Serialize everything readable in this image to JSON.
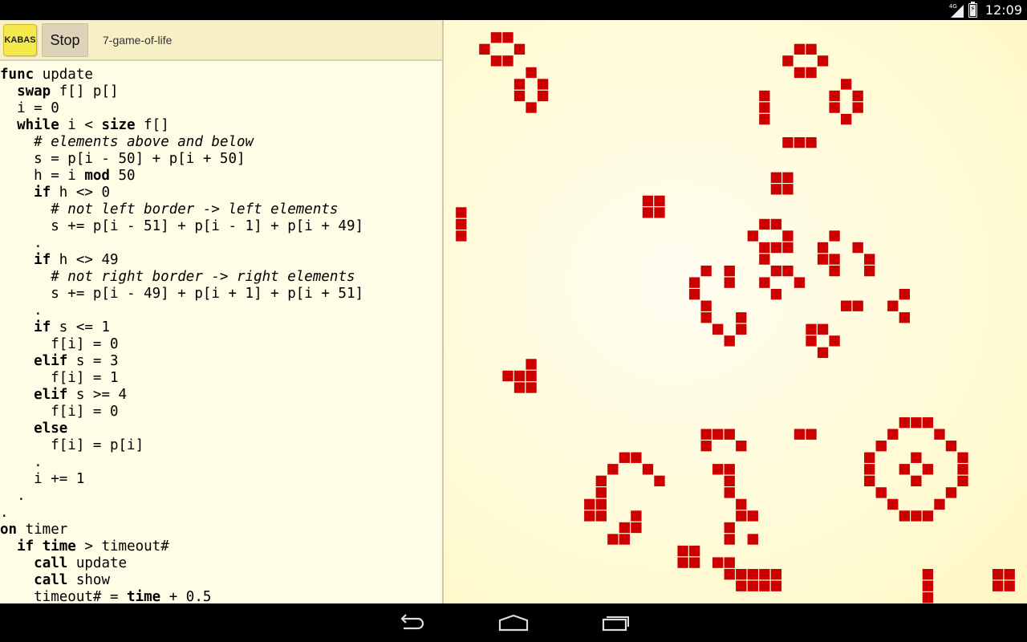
{
  "status_bar": {
    "network": "4G",
    "time": "12:09"
  },
  "toolbar": {
    "logo_text": "KABAS",
    "stop_label": "Stop",
    "program_name": "7-game-of-life"
  },
  "editor": {
    "lines": [
      [
        {
          "k": "kw",
          "t": "func"
        },
        {
          "k": "",
          "t": " update"
        }
      ],
      [
        {
          "k": "",
          "t": "  "
        },
        {
          "k": "kw",
          "t": "swap"
        },
        {
          "k": "",
          "t": " f[] p[]"
        }
      ],
      [
        {
          "k": "",
          "t": "  i = 0"
        }
      ],
      [
        {
          "k": "",
          "t": "  "
        },
        {
          "k": "kw",
          "t": "while"
        },
        {
          "k": "",
          "t": " i < "
        },
        {
          "k": "kw",
          "t": "size"
        },
        {
          "k": "",
          "t": " f[]"
        }
      ],
      [
        {
          "k": "",
          "t": "    "
        },
        {
          "k": "cm",
          "t": "# elements above and below"
        }
      ],
      [
        {
          "k": "",
          "t": "    s = p[i - 50] + p[i + 50]"
        }
      ],
      [
        {
          "k": "",
          "t": "    h = i "
        },
        {
          "k": "kw",
          "t": "mod"
        },
        {
          "k": "",
          "t": " 50"
        }
      ],
      [
        {
          "k": "",
          "t": "    "
        },
        {
          "k": "kw",
          "t": "if"
        },
        {
          "k": "",
          "t": " h <> 0"
        }
      ],
      [
        {
          "k": "",
          "t": "      "
        },
        {
          "k": "cm",
          "t": "# not left border -> left elements"
        }
      ],
      [
        {
          "k": "",
          "t": "      s += p[i - 51] + p[i - 1] + p[i + 49]"
        }
      ],
      [
        {
          "k": "",
          "t": "    ."
        }
      ],
      [
        {
          "k": "",
          "t": "    "
        },
        {
          "k": "kw",
          "t": "if"
        },
        {
          "k": "",
          "t": " h <> 49"
        }
      ],
      [
        {
          "k": "",
          "t": "      "
        },
        {
          "k": "cm",
          "t": "# not right border -> right elements"
        }
      ],
      [
        {
          "k": "",
          "t": "      s += p[i - 49] + p[i + 1] + p[i + 51]"
        }
      ],
      [
        {
          "k": "",
          "t": "    ."
        }
      ],
      [
        {
          "k": "",
          "t": "    "
        },
        {
          "k": "kw",
          "t": "if"
        },
        {
          "k": "",
          "t": " s <= 1"
        }
      ],
      [
        {
          "k": "",
          "t": "      f[i] = 0"
        }
      ],
      [
        {
          "k": "",
          "t": "    "
        },
        {
          "k": "kw",
          "t": "elif"
        },
        {
          "k": "",
          "t": " s = 3"
        }
      ],
      [
        {
          "k": "",
          "t": "      f[i] = 1"
        }
      ],
      [
        {
          "k": "",
          "t": "    "
        },
        {
          "k": "kw",
          "t": "elif"
        },
        {
          "k": "",
          "t": " s >= 4"
        }
      ],
      [
        {
          "k": "",
          "t": "      f[i] = 0"
        }
      ],
      [
        {
          "k": "",
          "t": "    "
        },
        {
          "k": "kw",
          "t": "else"
        }
      ],
      [
        {
          "k": "",
          "t": "      f[i] = p[i]"
        }
      ],
      [
        {
          "k": "",
          "t": "    ."
        }
      ],
      [
        {
          "k": "",
          "t": "    i += 1"
        }
      ],
      [
        {
          "k": "",
          "t": "  ."
        }
      ],
      [
        {
          "k": "",
          "t": "."
        }
      ],
      [
        {
          "k": "kw",
          "t": "on"
        },
        {
          "k": "",
          "t": " timer"
        }
      ],
      [
        {
          "k": "",
          "t": "  "
        },
        {
          "k": "kw",
          "t": "if"
        },
        {
          "k": "",
          "t": " "
        },
        {
          "k": "kw",
          "t": "time"
        },
        {
          "k": "",
          "t": " > timeout#"
        }
      ],
      [
        {
          "k": "",
          "t": "    "
        },
        {
          "k": "kw",
          "t": "call"
        },
        {
          "k": "",
          "t": " update"
        }
      ],
      [
        {
          "k": "",
          "t": "    "
        },
        {
          "k": "kw",
          "t": "call"
        },
        {
          "k": "",
          "t": " show"
        }
      ],
      [
        {
          "k": "",
          "t": "    timeout# = "
        },
        {
          "k": "kw",
          "t": "time"
        },
        {
          "k": "",
          "t": " + 0.5"
        }
      ]
    ]
  },
  "game": {
    "grid_size": 50,
    "cell_color": "#cc0000",
    "live_cells": [
      [
        4,
        1
      ],
      [
        5,
        1
      ],
      [
        3,
        2
      ],
      [
        6,
        2
      ],
      [
        4,
        3
      ],
      [
        5,
        3
      ],
      [
        7,
        4
      ],
      [
        6,
        5
      ],
      [
        8,
        5
      ],
      [
        6,
        6
      ],
      [
        8,
        6
      ],
      [
        7,
        7
      ],
      [
        30,
        2
      ],
      [
        31,
        2
      ],
      [
        29,
        3
      ],
      [
        32,
        3
      ],
      [
        30,
        4
      ],
      [
        31,
        4
      ],
      [
        34,
        5
      ],
      [
        27,
        6
      ],
      [
        33,
        6
      ],
      [
        35,
        6
      ],
      [
        27,
        7
      ],
      [
        33,
        7
      ],
      [
        35,
        7
      ],
      [
        27,
        8
      ],
      [
        34,
        8
      ],
      [
        29,
        10
      ],
      [
        30,
        10
      ],
      [
        31,
        10
      ],
      [
        28,
        13
      ],
      [
        29,
        13
      ],
      [
        28,
        14
      ],
      [
        29,
        14
      ],
      [
        17,
        15
      ],
      [
        18,
        15
      ],
      [
        17,
        16
      ],
      [
        18,
        16
      ],
      [
        1,
        16
      ],
      [
        1,
        17
      ],
      [
        1,
        18
      ],
      [
        27,
        17
      ],
      [
        28,
        17
      ],
      [
        26,
        18
      ],
      [
        29,
        18
      ],
      [
        27,
        19
      ],
      [
        28,
        19
      ],
      [
        29,
        19
      ],
      [
        27,
        20
      ],
      [
        33,
        18
      ],
      [
        32,
        19
      ],
      [
        35,
        19
      ],
      [
        32,
        20
      ],
      [
        33,
        20
      ],
      [
        36,
        20
      ],
      [
        33,
        21
      ],
      [
        36,
        21
      ],
      [
        22,
        21
      ],
      [
        24,
        21
      ],
      [
        28,
        21
      ],
      [
        29,
        21
      ],
      [
        21,
        22
      ],
      [
        24,
        22
      ],
      [
        27,
        22
      ],
      [
        30,
        22
      ],
      [
        21,
        23
      ],
      [
        28,
        23
      ],
      [
        22,
        24
      ],
      [
        22,
        25
      ],
      [
        25,
        25
      ],
      [
        23,
        26
      ],
      [
        25,
        26
      ],
      [
        24,
        27
      ],
      [
        31,
        26
      ],
      [
        32,
        26
      ],
      [
        31,
        27
      ],
      [
        33,
        27
      ],
      [
        32,
        28
      ],
      [
        34,
        24
      ],
      [
        35,
        24
      ],
      [
        38,
        24
      ],
      [
        39,
        23
      ],
      [
        39,
        25
      ],
      [
        7,
        29
      ],
      [
        6,
        30
      ],
      [
        7,
        30
      ],
      [
        5,
        30
      ],
      [
        6,
        31
      ],
      [
        7,
        31
      ],
      [
        22,
        35
      ],
      [
        23,
        35
      ],
      [
        24,
        35
      ],
      [
        22,
        36
      ],
      [
        25,
        36
      ],
      [
        30,
        35
      ],
      [
        31,
        35
      ],
      [
        39,
        34
      ],
      [
        40,
        34
      ],
      [
        41,
        34
      ],
      [
        38,
        35
      ],
      [
        42,
        35
      ],
      [
        37,
        36
      ],
      [
        43,
        36
      ],
      [
        15,
        37
      ],
      [
        16,
        37
      ],
      [
        14,
        38
      ],
      [
        17,
        38
      ],
      [
        13,
        39
      ],
      [
        18,
        39
      ],
      [
        13,
        40
      ],
      [
        12,
        41
      ],
      [
        13,
        41
      ],
      [
        12,
        42
      ],
      [
        13,
        42
      ],
      [
        16,
        42
      ],
      [
        15,
        43
      ],
      [
        16,
        43
      ],
      [
        14,
        44
      ],
      [
        15,
        44
      ],
      [
        23,
        38
      ],
      [
        24,
        38
      ],
      [
        24,
        39
      ],
      [
        24,
        40
      ],
      [
        25,
        41
      ],
      [
        25,
        42
      ],
      [
        26,
        42
      ],
      [
        24,
        43
      ],
      [
        24,
        44
      ],
      [
        26,
        44
      ],
      [
        36,
        37
      ],
      [
        40,
        37
      ],
      [
        44,
        37
      ],
      [
        36,
        38
      ],
      [
        39,
        38
      ],
      [
        41,
        38
      ],
      [
        44,
        38
      ],
      [
        36,
        39
      ],
      [
        40,
        39
      ],
      [
        44,
        39
      ],
      [
        37,
        40
      ],
      [
        43,
        40
      ],
      [
        38,
        41
      ],
      [
        42,
        41
      ],
      [
        39,
        42
      ],
      [
        40,
        42
      ],
      [
        41,
        42
      ],
      [
        20,
        45
      ],
      [
        21,
        45
      ],
      [
        20,
        46
      ],
      [
        21,
        46
      ],
      [
        23,
        46
      ],
      [
        24,
        46
      ],
      [
        24,
        47
      ],
      [
        25,
        47
      ],
      [
        26,
        47
      ],
      [
        27,
        47
      ],
      [
        28,
        47
      ],
      [
        25,
        48
      ],
      [
        26,
        48
      ],
      [
        27,
        48
      ],
      [
        28,
        48
      ],
      [
        41,
        47
      ],
      [
        41,
        48
      ],
      [
        41,
        49
      ],
      [
        47,
        47
      ],
      [
        48,
        47
      ],
      [
        47,
        48
      ],
      [
        48,
        48
      ]
    ]
  },
  "nav": {
    "back": "back-icon",
    "home": "home-icon",
    "recents": "recents-icon"
  }
}
